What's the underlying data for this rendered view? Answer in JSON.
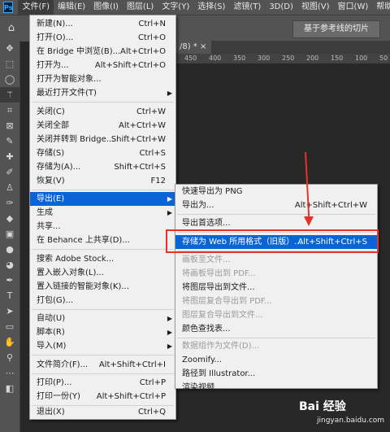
{
  "app": {
    "logo": "Ps"
  },
  "menubar": [
    "文件(F)",
    "编辑(E)",
    "图像(I)",
    "图层(L)",
    "文字(Y)",
    "选择(S)",
    "滤镜(T)",
    "3D(D)",
    "视图(V)",
    "窗口(W)",
    "帮助("
  ],
  "options": {
    "slices_label": "基于参考线的切片"
  },
  "tab": {
    "title": "/8) * ×"
  },
  "ruler": [
    "450",
    "400",
    "350",
    "300",
    "250",
    "200",
    "150",
    "100",
    "50"
  ],
  "file_menu": [
    {
      "label": "新建(N)...",
      "shortcut": "Ctrl+N"
    },
    {
      "label": "打开(O)...",
      "shortcut": "Ctrl+O"
    },
    {
      "label": "在 Bridge 中浏览(B)...",
      "shortcut": "Alt+Ctrl+O"
    },
    {
      "label": "打开为...",
      "shortcut": "Alt+Shift+Ctrl+O"
    },
    {
      "label": "打开为智能对象...",
      "shortcut": ""
    },
    {
      "label": "最近打开文件(T)",
      "shortcut": ""
    },
    {
      "label": "关闭(C)",
      "shortcut": "Ctrl+W"
    },
    {
      "label": "关闭全部",
      "shortcut": "Alt+Ctrl+W"
    },
    {
      "label": "关闭并转到 Bridge...",
      "shortcut": "Shift+Ctrl+W"
    },
    {
      "label": "存储(S)",
      "shortcut": "Ctrl+S"
    },
    {
      "label": "存储为(A)...",
      "shortcut": "Shift+Ctrl+S"
    },
    {
      "label": "恢复(V)",
      "shortcut": "F12"
    },
    {
      "label": "导出(E)",
      "shortcut": ""
    },
    {
      "label": "生成",
      "shortcut": ""
    },
    {
      "label": "共享...",
      "shortcut": ""
    },
    {
      "label": "在 Behance 上共享(D)...",
      "shortcut": ""
    },
    {
      "label": "搜索 Adobe Stock...",
      "shortcut": ""
    },
    {
      "label": "置入嵌入对象(L)...",
      "shortcut": ""
    },
    {
      "label": "置入链接的智能对象(K)...",
      "shortcut": ""
    },
    {
      "label": "打包(G)...",
      "shortcut": ""
    },
    {
      "label": "自动(U)",
      "shortcut": ""
    },
    {
      "label": "脚本(R)",
      "shortcut": ""
    },
    {
      "label": "导入(M)",
      "shortcut": ""
    },
    {
      "label": "文件简介(F)...",
      "shortcut": "Alt+Shift+Ctrl+I"
    },
    {
      "label": "打印(P)...",
      "shortcut": "Ctrl+P"
    },
    {
      "label": "打印一份(Y)",
      "shortcut": "Alt+Shift+Ctrl+P"
    },
    {
      "label": "退出(X)",
      "shortcut": "Ctrl+Q"
    }
  ],
  "export_menu": [
    {
      "label": "快速导出为 PNG",
      "shortcut": ""
    },
    {
      "label": "导出为...",
      "shortcut": "Alt+Shift+Ctrl+W"
    },
    {
      "label": "导出首选项...",
      "shortcut": ""
    },
    {
      "label": "存储为 Web 所用格式（旧版）...",
      "shortcut": "Alt+Shift+Ctrl+S"
    },
    {
      "label": "画板至文件...",
      "shortcut": ""
    },
    {
      "label": "将画板导出到 PDF...",
      "shortcut": ""
    },
    {
      "label": "将图层导出到文件...",
      "shortcut": ""
    },
    {
      "label": "将图层复合导出到 PDF...",
      "shortcut": ""
    },
    {
      "label": "图层复合导出到文件...",
      "shortcut": ""
    },
    {
      "label": "颜色查找表...",
      "shortcut": ""
    },
    {
      "label": "数据组作为文件(D)...",
      "shortcut": ""
    },
    {
      "label": "Zoomify...",
      "shortcut": ""
    },
    {
      "label": "路径到 Illustrator...",
      "shortcut": ""
    },
    {
      "label": "渲染视频...",
      "shortcut": ""
    }
  ],
  "watermark": {
    "logo": "Bai 经验",
    "url": "jingyan.baidu.com"
  },
  "colors": {
    "highlight": "#0a64d6",
    "annotation_red": "#e4332c"
  }
}
